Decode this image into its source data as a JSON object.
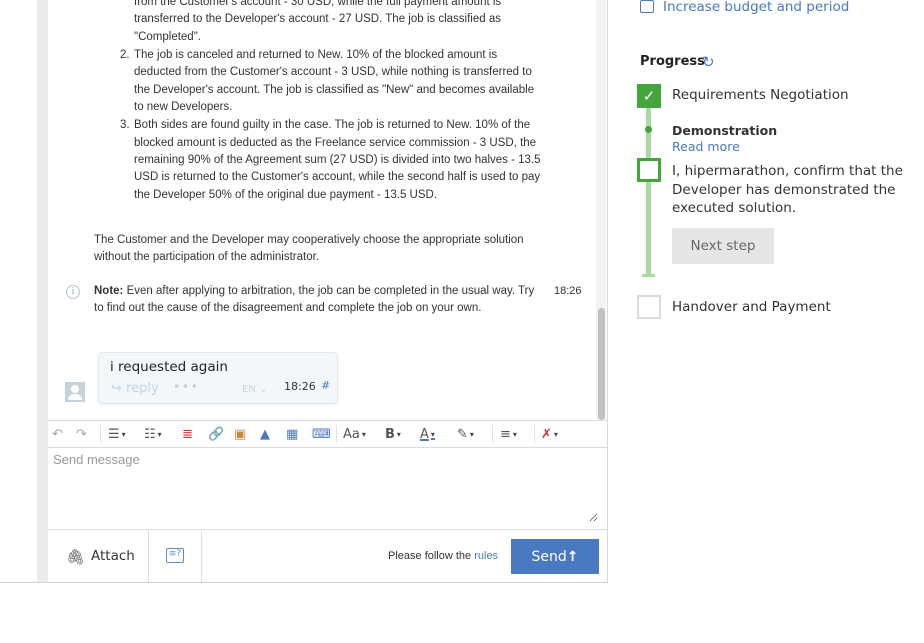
{
  "chat": {
    "option1_tail": "from the Customer's account - 30 USD, while the full payment amount is transferred to the Developer's account - 27 USD. The job is classified as \"Completed\".",
    "options": [
      {
        "num": "2.",
        "text": "The job is canceled and returned to New. 10% of the blocked amount is deducted from the Customer's account - 3 USD, while nothing is transferred to the Developer's account. The job is classified as \"New\" and becomes available to new Developers."
      },
      {
        "num": "3.",
        "text": "Both sides are found guilty in the case. The job is returned to New. 10% of the blocked amount is deducted as the Freelance service commission - 3 USD, the remaining 90% of the Agreement sum (27 USD) is divided into two halves - 13.5 USD is returned to the Customer's account, while the second half is used to pay the Developer 50% of the original due payment - 13.5 USD."
      }
    ],
    "cooperative_text": "The Customer and the Developer may cooperatively choose the appropriate solution without the participation of the administrator.",
    "note_label": "Note:",
    "note_text": " Even after applying to arbitration, the job can be completed in the usual way. Try to find out the cause of the disagreement and complete the job on your own.",
    "note_time": "18:26",
    "message": {
      "text": "i requested again",
      "reply_label": "reply",
      "dots": "•••",
      "lang": "EN",
      "time": "18:26",
      "hash": "#"
    }
  },
  "composer": {
    "placeholder": "Send message",
    "attach_label": "Attach",
    "rules_prefix": "Please follow the ",
    "rules_link": "rules",
    "send_label": "Send"
  },
  "toolbar": {
    "icons": [
      "undo-icon",
      "redo-icon",
      "bulleted-list-icon",
      "numbered-list-icon",
      "strikethrough-icon",
      "link-icon",
      "user-photo-icon",
      "image-icon",
      "table-icon",
      "code-icon",
      "font-size-icon",
      "bold-icon",
      "font-color-icon",
      "highlight-icon",
      "align-icon",
      "clear-format-icon"
    ],
    "font_size_label": "Aa",
    "bold_label": "B",
    "font_color_label": "A"
  },
  "sidebar": {
    "budget_link": "Increase budget and period",
    "progress_title": "Progress",
    "steps": [
      {
        "label": "Requirements Negotiation",
        "state": "done"
      },
      {
        "label": "Demonstration",
        "state": "current",
        "read_more": "Read more",
        "confirm_text": "I, hipermarathon, confirm that the Developer has demonstrated the executed solution.",
        "button": "Next step"
      },
      {
        "label": "Handover and Payment",
        "state": "pending"
      }
    ]
  },
  "colors": {
    "accent_blue": "#4a78c1",
    "progress_green": "#43a63b",
    "progress_line": "#a8dba1"
  }
}
